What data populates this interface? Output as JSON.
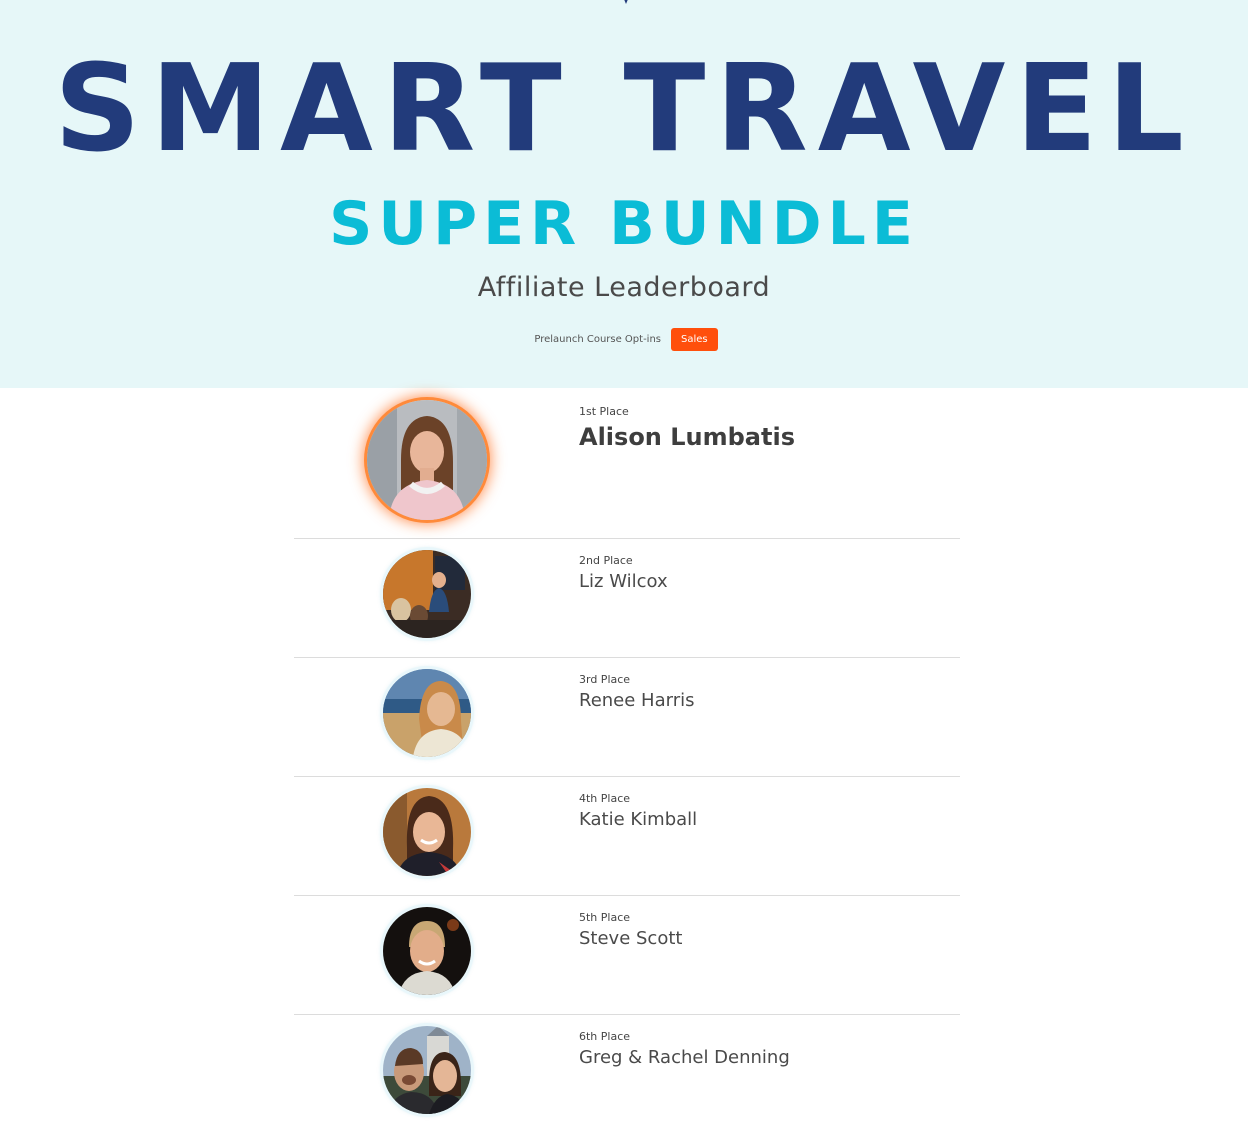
{
  "header": {
    "title": "SMART TRAVEL",
    "subtitle": "SUPER BUNDLE",
    "tagline": "Affiliate Leaderboard",
    "tabs": [
      {
        "label": "Prelaunch Course Opt-ins",
        "active": false
      },
      {
        "label": "Sales",
        "active": true
      }
    ]
  },
  "colors": {
    "title": "#223b7b",
    "subtitle": "#0bbcd6",
    "hero_background": "#e6f7f8",
    "active_tab": "#ff4f0c"
  },
  "leaderboard": [
    {
      "place": "1st Place",
      "name": "Alison Lumbatis",
      "avatar": "photo-avatar"
    },
    {
      "place": "2nd Place",
      "name": "Liz Wilcox",
      "avatar": "photo-avatar"
    },
    {
      "place": "3rd Place",
      "name": "Renee Harris",
      "avatar": "photo-avatar"
    },
    {
      "place": "4th Place",
      "name": "Katie Kimball",
      "avatar": "photo-avatar"
    },
    {
      "place": "5th Place",
      "name": "Steve Scott",
      "avatar": "photo-avatar"
    },
    {
      "place": "6th Place",
      "name": "Greg & Rachel Denning",
      "avatar": "photo-avatar"
    }
  ]
}
